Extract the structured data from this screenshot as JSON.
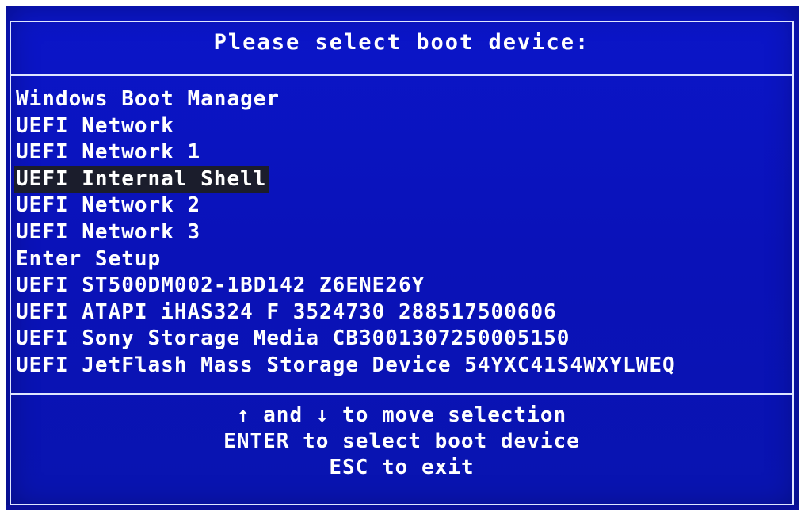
{
  "screen": {
    "title": "Please select boot device:",
    "boot_devices": [
      {
        "label": "Windows Boot Manager",
        "selected": false
      },
      {
        "label": "UEFI Network",
        "selected": false
      },
      {
        "label": "UEFI Network 1",
        "selected": false
      },
      {
        "label": "UEFI Internal Shell",
        "selected": true
      },
      {
        "label": "UEFI Network 2",
        "selected": false
      },
      {
        "label": "UEFI Network 3",
        "selected": false
      },
      {
        "label": "Enter Setup",
        "selected": false
      },
      {
        "label": "UEFI ST500DM002-1BD142 Z6ENE26Y",
        "selected": false
      },
      {
        "label": "UEFI ATAPI iHAS324 F 3524730 288517500606",
        "selected": false
      },
      {
        "label": "UEFI Sony Storage Media CB3001307250005150",
        "selected": false
      },
      {
        "label": "UEFI JetFlash Mass Storage Device 54YXC41S4WXYLWEQ",
        "selected": false
      }
    ],
    "help": [
      "↑ and ↓ to move selection",
      "ENTER to select boot device",
      "ESC to exit"
    ]
  },
  "colors": {
    "background": "#0a14c8",
    "text": "#ffffff",
    "border": "#dfe6ff",
    "selection_highlight": "#1b1d2c"
  }
}
